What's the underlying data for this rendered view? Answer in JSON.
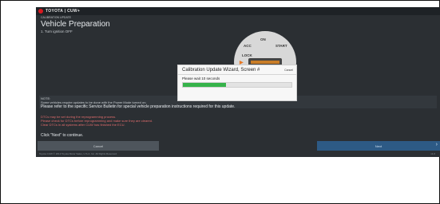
{
  "header": {
    "brand": "TOYOTA | CUW+"
  },
  "page": {
    "breadcrumb": "CALIBRATION UPDATE",
    "title": "Vehicle Preparation",
    "step": "1. Turn ignition OFF",
    "ignition_labels": {
      "acc": "ACC",
      "on": "ON",
      "start": "START",
      "lock": "LOCK"
    }
  },
  "notes": {
    "label": "NOTE:",
    "line1": "Some vehicles require updates to be done with the Power Mode turned on.",
    "line2": "Please refer to the specific Service Bulletin for special vehicle preparation instructions required for this update.",
    "warn1": "DTCs may be set during the reprogramming process.",
    "warn2": "Please check for DTCs before reprogramming and make sure they are cleared.",
    "warn3": "Clear DTCs in all systems after CUW has finished the ECU.",
    "click_next": "Click \"Next\" to continue."
  },
  "buttons": {
    "cancel": "Cancel",
    "next": "Next"
  },
  "footer": {
    "left": "Toyota CUW © 2013 Toyota Motor Sales, U.S.A. Inc. All Rights Reserved.",
    "right": "v1.0"
  },
  "modal": {
    "title": "Calibration Update Wizard, Screen #",
    "cancel": "Cancel",
    "message": "Please wait 10 seconds",
    "progress": 0.4
  },
  "colors": {
    "accent": "#36b34a",
    "brand": "#d71920",
    "next": "#2d5a85"
  }
}
